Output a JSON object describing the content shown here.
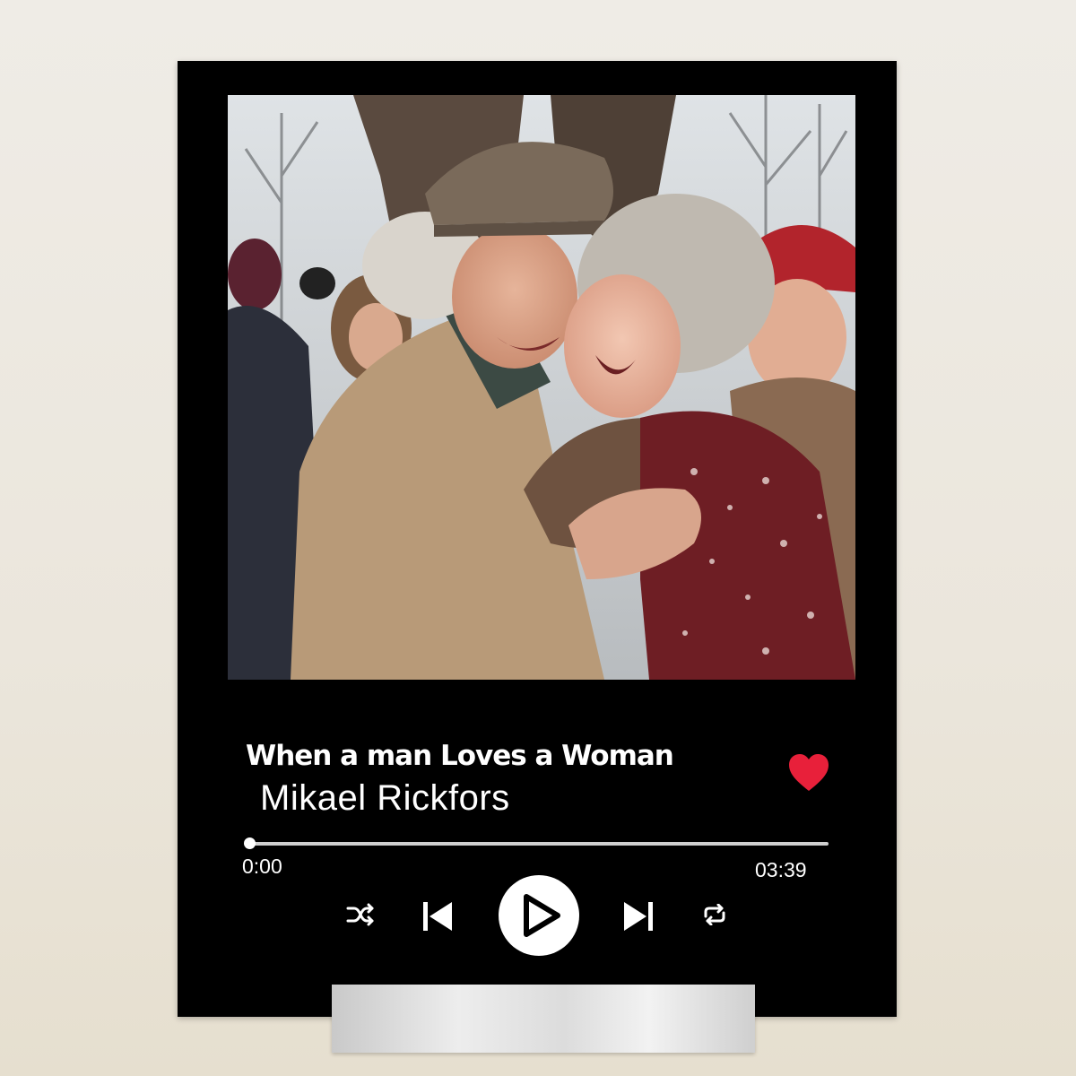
{
  "player": {
    "song_title": "When a man Loves a Woman",
    "artist": "Mikael Rickfors",
    "time_elapsed": "0:00",
    "time_total": "03:39",
    "progress_fraction": 0.0,
    "liked": true
  },
  "controls": {
    "shuffle_icon": "shuffle-icon",
    "previous_icon": "skip-previous-icon",
    "play_icon": "play-icon",
    "next_icon": "skip-next-icon",
    "repeat_icon": "repeat-icon"
  },
  "colors": {
    "plaque_background": "#000000",
    "text": "#ffffff",
    "heart": "#e8203a",
    "track": "#cfcfcf"
  }
}
